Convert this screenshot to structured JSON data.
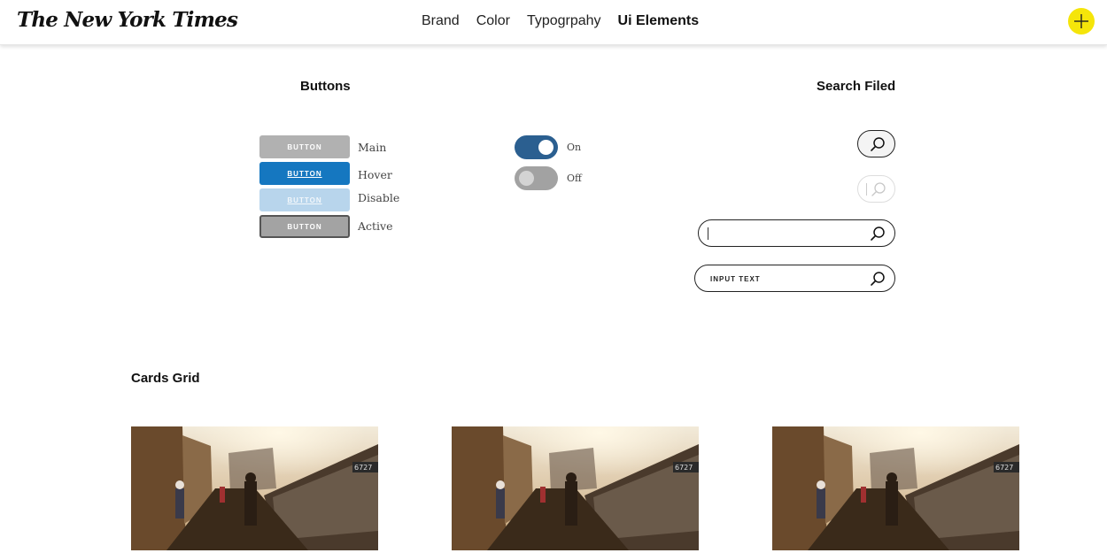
{
  "header": {
    "logo": "The New York Times",
    "nav": [
      {
        "label": "Brand",
        "active": false
      },
      {
        "label": "Color",
        "active": false
      },
      {
        "label": "Typogrpahy",
        "active": false
      },
      {
        "label": "Ui Elements",
        "active": true
      }
    ],
    "accent_color": "#f5e50a"
  },
  "sections": {
    "buttons_title": "Buttons",
    "search_title": "Search Filed",
    "cards_title": "Cards Grid"
  },
  "buttons": [
    {
      "label": "BUTTON",
      "caption": "Main",
      "color": "#b1b1b1"
    },
    {
      "label": "BUTTON",
      "caption": "Hover",
      "color": "#1577c0"
    },
    {
      "label": "BUTTON",
      "caption": "Disable",
      "color": "#b8d5ec"
    },
    {
      "label": "BUTTON",
      "caption": "Active",
      "color": "#a3a3a3"
    }
  ],
  "toggles": [
    {
      "label": "On",
      "state": true,
      "color": "#2b5f90"
    },
    {
      "label": "Off",
      "state": false,
      "color": "#a2a2a2"
    }
  ],
  "search": {
    "filled_value": "INPUT TEXT",
    "icon": "search-icon"
  },
  "cards": [
    {
      "image": "subway-platform-photo"
    },
    {
      "image": "subway-platform-photo"
    },
    {
      "image": "subway-platform-photo"
    }
  ],
  "photo_train_number": "6727"
}
